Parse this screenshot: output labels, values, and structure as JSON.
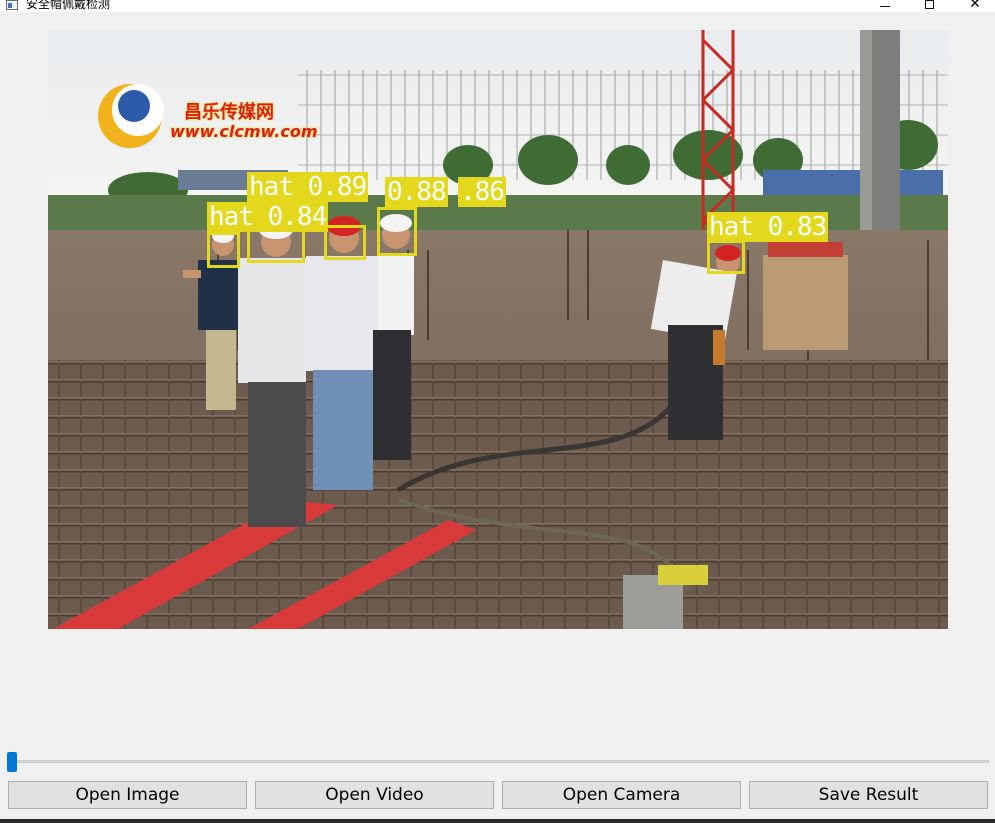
{
  "window": {
    "title": "安全帽佩戴检测",
    "icon": "app-window-icon",
    "controls": [
      "minimize-icon",
      "maximize-icon",
      "close-icon"
    ]
  },
  "image": {
    "watermark": {
      "line1": "昌乐传媒网",
      "line2": "www.clcmw.com"
    },
    "detections": [
      {
        "label": "hat 0.84"
      },
      {
        "label": "hat 0.89"
      },
      {
        "label": "0.88"
      },
      {
        "label": ".86"
      },
      {
        "label": "hat 0.83"
      }
    ]
  },
  "slider": {
    "value": 0
  },
  "buttons": {
    "open_image": "Open Image",
    "open_video": "Open Video",
    "open_camera": "Open Camera",
    "save_result": "Save Result"
  },
  "colors": {
    "detection_box": "#e3d81c",
    "slider_handle": "#0078d7",
    "button_bg": "#e1e1e1",
    "window_bg": "#f0f0f0"
  }
}
